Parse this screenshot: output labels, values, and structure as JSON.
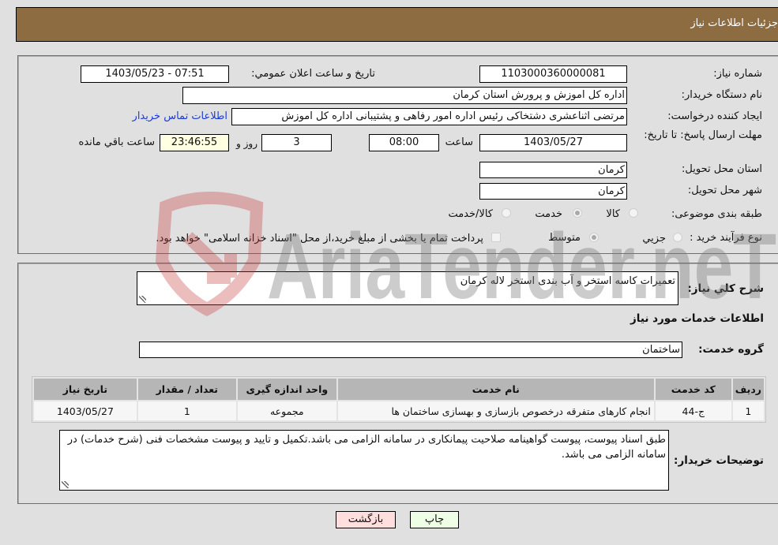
{
  "header": {
    "title": "جزئیات اطلاعات نیاز"
  },
  "need_info": {
    "need_number": {
      "label": "شماره نیاز:",
      "value": "1103000360000081"
    },
    "announce_datetime": {
      "label": "تاریخ و ساعت اعلان عمومي:",
      "value": "1403/05/23 - 07:51"
    },
    "buyer_org": {
      "label": "نام دستگاه خریدار:",
      "value": "اداره کل اموزش و پرورش استان کرمان"
    },
    "requester": {
      "label": "ایجاد کننده درخواست:",
      "value": "مرتضی اثناعشری دشتخاکی رئیس اداره امور رفاهی و پشتیبانی اداره کل اموزش",
      "contact_link": "اطلاعات تماس خریدار"
    },
    "deadline": {
      "label": "مهلت ارسال پاسخ: تا تاریخ:",
      "date": "1403/05/27",
      "time_label": "ساعت",
      "time": "08:00",
      "days": "3",
      "days_label": "روز و",
      "remaining": "23:46:55",
      "remaining_label": "ساعت باقي مانده"
    },
    "province": {
      "label": "استان محل تحویل:",
      "value": "کرمان"
    },
    "city": {
      "label": "شهر محل تحویل:",
      "value": "کرمان"
    },
    "category": {
      "label": "طبقه بندی موضوعی:",
      "options": [
        {
          "label": "کالا",
          "selected": false
        },
        {
          "label": "خدمت",
          "selected": true
        },
        {
          "label": "کالا/خدمت",
          "selected": false
        }
      ]
    },
    "purchase_type": {
      "label": "نوع فرآیند خرید :",
      "options": [
        {
          "label": "جزيي",
          "selected": false
        },
        {
          "label": "متوسط",
          "selected": true
        }
      ],
      "treasury_checked": false,
      "treasury_note": "پرداخت تمام یا بخشی از مبلغ خرید،از محل \"اسناد خزانه اسلامی\" خواهد بود."
    }
  },
  "description": {
    "label": "شرح کلي نياز:",
    "value": "تعمیرات کاسه استخر و آب بندی استخر لاله کرمان"
  },
  "services": {
    "heading": "اطلاعات خدمات مورد نیاز",
    "group_label": "گروه خدمت:",
    "group_value": "ساختمان",
    "columns": [
      "ردیف",
      "کد خدمت",
      "نام خدمت",
      "واحد اندازه گیری",
      "تعداد / مقدار",
      "تاریخ نیاز"
    ],
    "rows": [
      {
        "row": "1",
        "code": "ج-44",
        "name": "انجام کارهای متفرقه درخصوص بازسازی و بهسازی ساختمان ها",
        "unit": "مجموعه",
        "quantity": "1",
        "date": "1403/05/27"
      }
    ]
  },
  "buyer_notes": {
    "label": "توضیحات خریدار:",
    "value": "طبق اسناد پیوست، پیوست گواهینامه صلاحیت پیمانکاری در سامانه الزامی می باشد.تکمیل و تایید و پیوست مشخصات فنی (شرح خدمات) در سامانه الزامی می باشد."
  },
  "buttons": {
    "back": "بازگشت",
    "print": "چاپ"
  },
  "watermark": {
    "text": "AriaTender.neT"
  },
  "colors": {
    "header": "#8e6c42",
    "back_button": "#ffdede",
    "print_button": "#eeffe6",
    "timer_bg": "#ffffe2",
    "link": "#1a3bd6"
  }
}
